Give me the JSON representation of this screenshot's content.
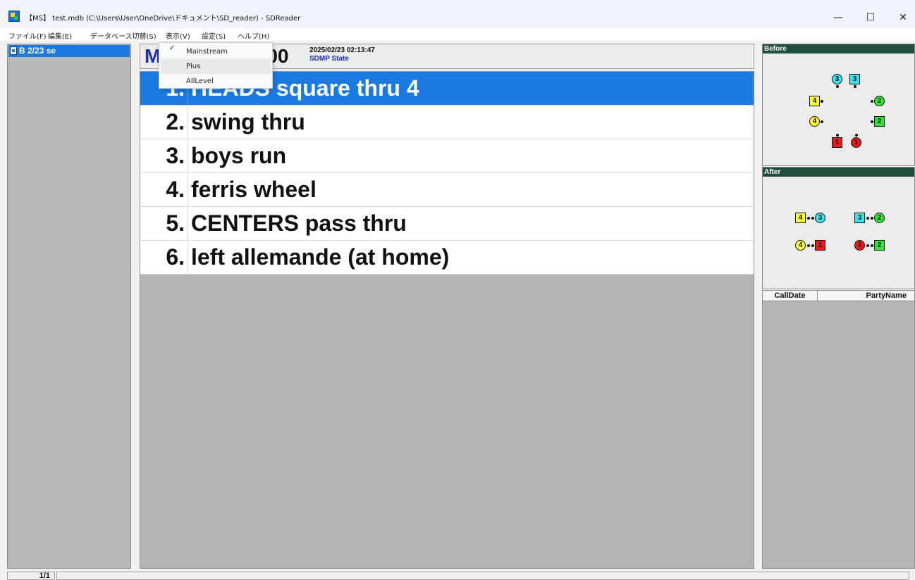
{
  "titlebar": {
    "title": "【MS】 test.mdb (C:\\Users\\User\\OneDrive\\ドキュメント\\SD_reader) - SDReader",
    "minimize": "—",
    "maximize": "☐",
    "close": "✕"
  },
  "menubar": {
    "items": [
      "ファイル(F)",
      "編集(E)",
      "データベース切替(S)",
      "表示(V)",
      "設定(S)",
      "ヘルプ(H)"
    ]
  },
  "sidebar": {
    "items": [
      {
        "label": "B 2/23 se"
      }
    ]
  },
  "header": {
    "level_initial": "M",
    "time_fragment": ":00",
    "date": "2025/02/23 02:13:47",
    "state": "SDMP State"
  },
  "dropdown": {
    "items": [
      {
        "label": "Mainstream",
        "checked": "✓"
      },
      {
        "label": "Plus"
      },
      {
        "label": "AllLevel"
      }
    ]
  },
  "sequence": {
    "rows": [
      {
        "num": "1.",
        "text": "HEADS square thru 4"
      },
      {
        "num": "2.",
        "text": "swing thru"
      },
      {
        "num": "3.",
        "text": "boys run"
      },
      {
        "num": "4.",
        "text": "ferris wheel"
      },
      {
        "num": "5.",
        "text": "CENTERS pass thru"
      },
      {
        "num": "6.",
        "text": "left allemande  (at home)"
      }
    ]
  },
  "before_panel": {
    "title": "Before",
    "dancers": [
      "3",
      "3",
      "4",
      "2",
      "4",
      "2",
      "1",
      "1"
    ]
  },
  "after_panel": {
    "title": "After",
    "dancers": [
      "4",
      "3",
      "3",
      "2",
      "4",
      "1",
      "1",
      "2"
    ]
  },
  "history_table": {
    "columns": [
      "CallDate",
      "PartyName"
    ]
  },
  "statusbar": {
    "page": "1/1"
  },
  "colors": {
    "accent": "#1a7ae0",
    "couple1": "#e81a1a",
    "couple2": "#2ee82e",
    "couple3": "#36e4ee",
    "couple4": "#ffff33"
  }
}
